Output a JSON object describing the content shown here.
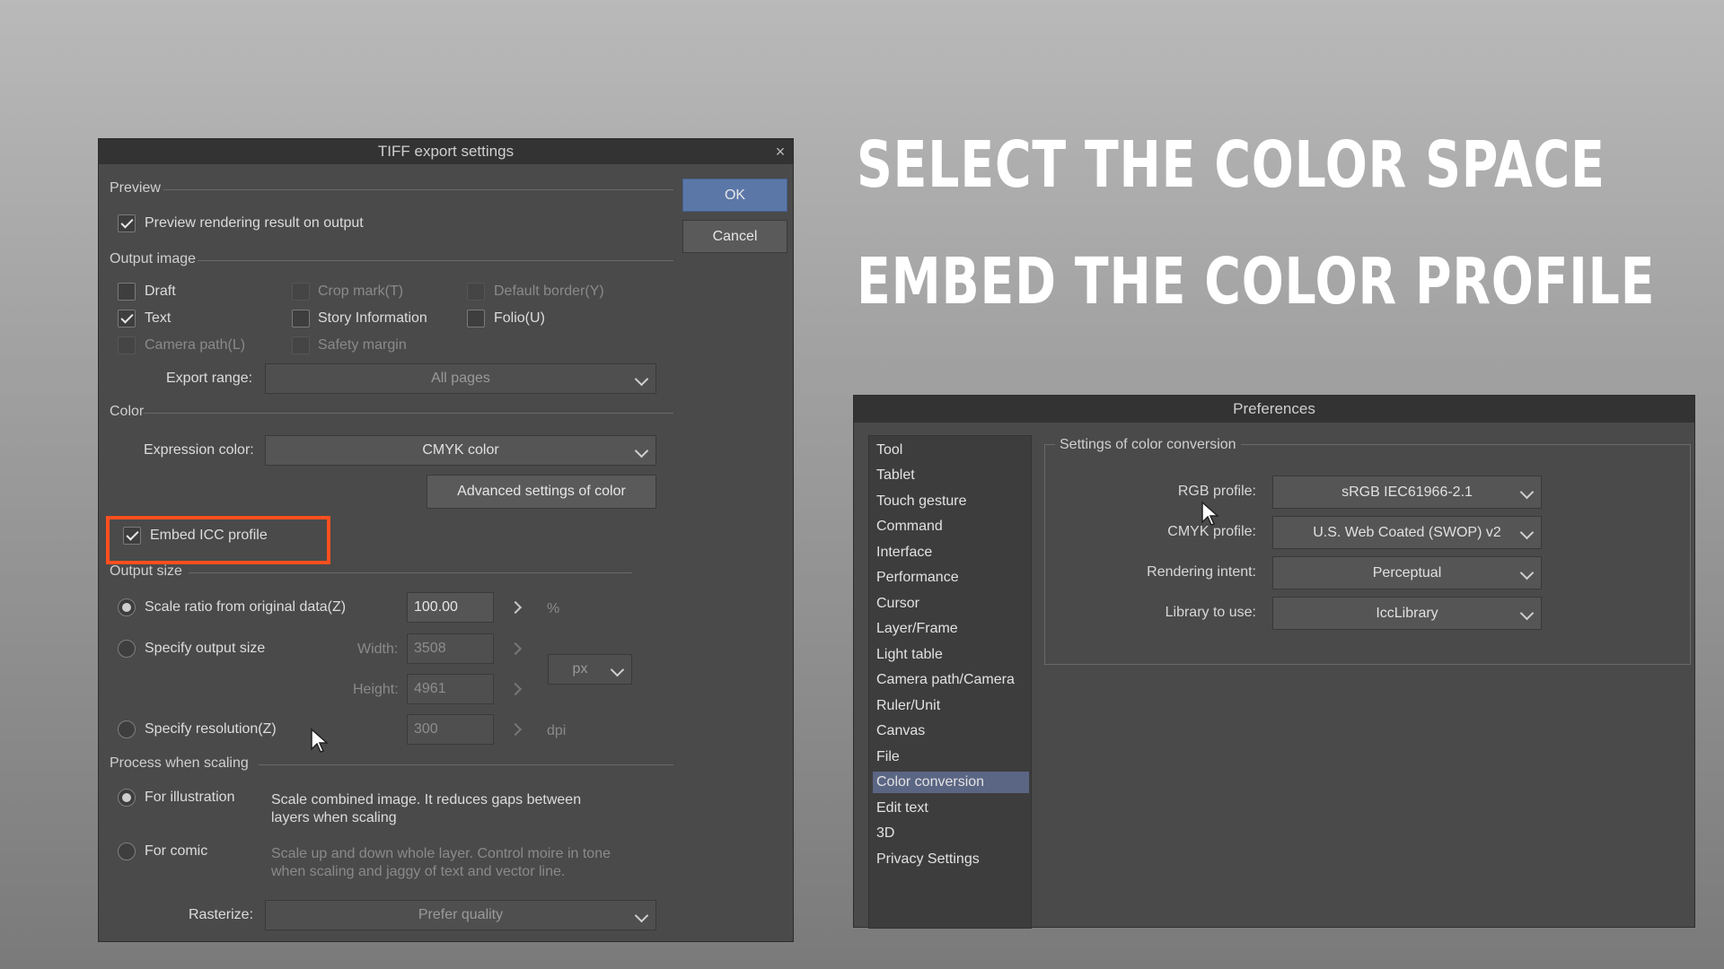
{
  "headlines": {
    "line1": "SELECT THE COLOR SPACE",
    "line2": "EMBED THE COLOR PROFILE"
  },
  "accent_color": "#ff4f1f",
  "tiff_dialog": {
    "title": "TIFF export settings",
    "close": "×",
    "ok_label": "OK",
    "cancel_label": "Cancel",
    "preview": {
      "group": "Preview",
      "checkbox_label": "Preview rendering result on output",
      "checked": true
    },
    "output_image": {
      "group": "Output image",
      "items": [
        {
          "label": "Draft",
          "checked": false,
          "enabled": true
        },
        {
          "label": "Crop mark(T)",
          "checked": false,
          "enabled": false
        },
        {
          "label": "Default border(Y)",
          "checked": false,
          "enabled": false
        },
        {
          "label": "Text",
          "checked": true,
          "enabled": true
        },
        {
          "label": "Story Information",
          "checked": false,
          "enabled": true
        },
        {
          "label": "Folio(U)",
          "checked": false,
          "enabled": true
        },
        {
          "label": "Camera path(L)",
          "checked": false,
          "enabled": false
        },
        {
          "label": "Safety margin",
          "checked": false,
          "enabled": false
        }
      ],
      "export_range_label": "Export range:",
      "export_range_value": "All pages"
    },
    "color": {
      "group": "Color",
      "expression_label": "Expression color:",
      "expression_value": "CMYK color",
      "advanced_button": "Advanced settings of color",
      "embed_label": "Embed ICC profile",
      "embed_checked": true
    },
    "output_size": {
      "group": "Output size",
      "scale_label": "Scale ratio from original data(Z)",
      "scale_value": "100.00",
      "scale_unit": "%",
      "specify_size_label": "Specify output size",
      "width_label": "Width:",
      "width_value": "3508",
      "height_label": "Height:",
      "height_value": "4961",
      "size_unit": "px",
      "resolution_label": "Specify resolution(Z)",
      "resolution_value": "300",
      "resolution_unit": "dpi",
      "selected": "scale"
    },
    "process": {
      "group": "Process when scaling",
      "illustration_label": "For illustration",
      "illustration_desc": "Scale combined image. It reduces gaps between layers when scaling",
      "comic_label": "For comic",
      "comic_desc": "Scale up and down whole layer. Control moire in tone when scaling and jaggy of text and vector line.",
      "selected": "illustration",
      "rasterize_label": "Rasterize:",
      "rasterize_value": "Prefer quality"
    }
  },
  "preferences": {
    "title": "Preferences",
    "nav": [
      "Tool",
      "Tablet",
      "Touch gesture",
      "Command",
      "Interface",
      "Performance",
      "Cursor",
      "Layer/Frame",
      "Light table",
      "Camera path/Camera",
      "Ruler/Unit",
      "Canvas",
      "File",
      "Color conversion",
      "Edit text",
      "3D",
      "Privacy Settings"
    ],
    "selected_nav": "Color conversion",
    "group": "Settings of color conversion",
    "rows": [
      {
        "label": "RGB profile:",
        "value": "sRGB IEC61966-2.1"
      },
      {
        "label": "CMYK profile:",
        "value": "U.S. Web Coated (SWOP) v2"
      },
      {
        "label": "Rendering intent:",
        "value": "Perceptual"
      },
      {
        "label": "Library to use:",
        "value": "IccLibrary"
      }
    ]
  }
}
